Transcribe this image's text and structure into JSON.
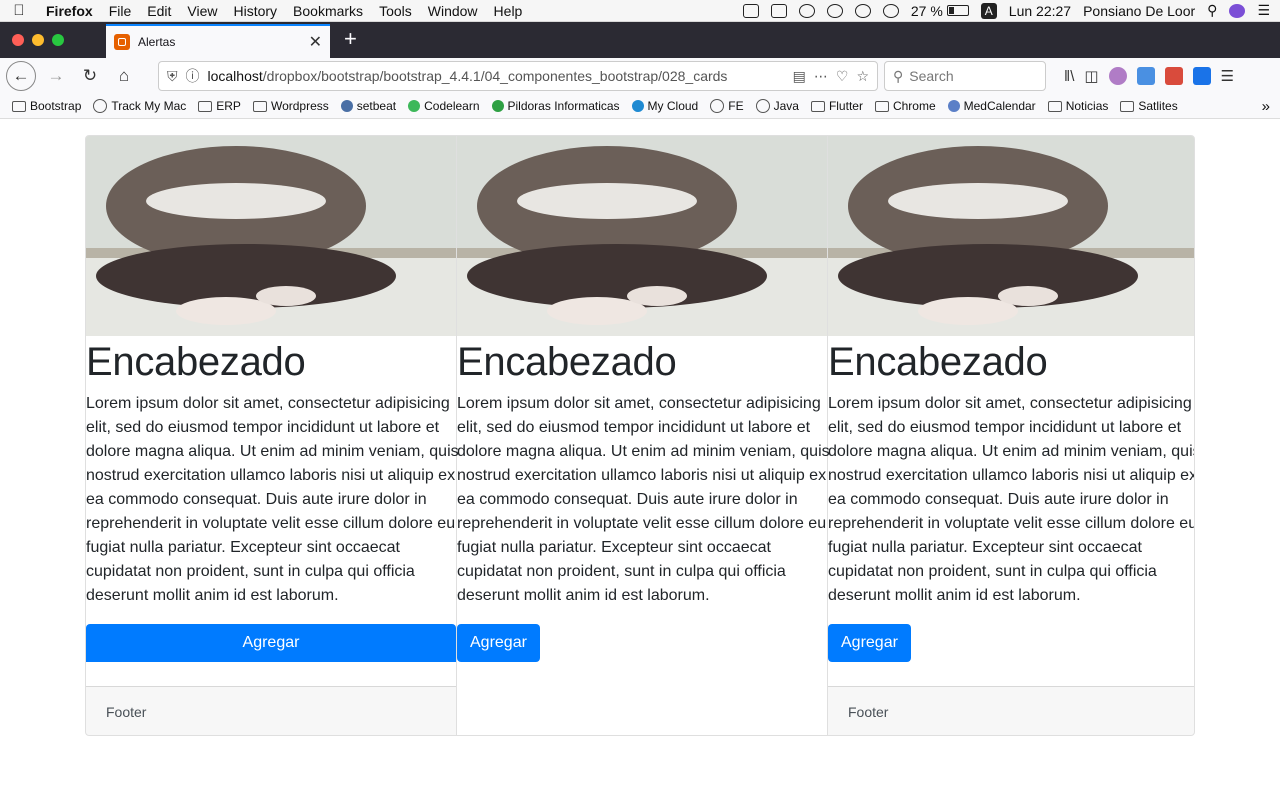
{
  "menubar": {
    "app": "Firefox",
    "menus": [
      "File",
      "Edit",
      "View",
      "History",
      "Bookmarks",
      "Tools",
      "Window",
      "Help"
    ],
    "battery": "27 %",
    "input_source": "A",
    "clock": "Lun 22:27",
    "user": "Ponsiano De Loor"
  },
  "tab": {
    "title": "Alertas"
  },
  "toolbar": {
    "url_host": "localhost",
    "url_path": "/dropbox/bootstrap/bootstrap_4.4.1/04_componentes_bootstrap/028_cards",
    "search_placeholder": "Search"
  },
  "bookmarks": [
    {
      "label": "Bootstrap",
      "icon": "folder-icon"
    },
    {
      "label": "Track My Mac",
      "icon": "globe-icon"
    },
    {
      "label": "ERP",
      "icon": "folder-icon"
    },
    {
      "label": "Wordpress",
      "icon": "folder-icon"
    },
    {
      "label": "setbeat",
      "icon": "headphones-icon"
    },
    {
      "label": "Codelearn",
      "icon": "codelearn-icon"
    },
    {
      "label": "Pildoras Informaticas",
      "icon": "pildoras-icon"
    },
    {
      "label": "My Cloud",
      "icon": "cloud-icon"
    },
    {
      "label": "FE",
      "icon": "globe-icon"
    },
    {
      "label": "Java",
      "icon": "globe-icon"
    },
    {
      "label": "Flutter",
      "icon": "folder-icon"
    },
    {
      "label": "Chrome",
      "icon": "folder-icon"
    },
    {
      "label": "MedCalendar",
      "icon": "medcalendar-icon"
    },
    {
      "label": "Noticias",
      "icon": "folder-icon"
    },
    {
      "label": "Satlites",
      "icon": "folder-icon"
    }
  ],
  "cards": [
    {
      "title": "Encabezado",
      "text": "Lorem ipsum dolor sit amet, consectetur adipisicing elit, sed do eiusmod tempor incididunt ut labore et dolore magna aliqua. Ut enim ad minim veniam, quis nostrud exercitation ullamco laboris nisi ut aliquip ex ea commodo consequat. Duis aute irure dolor in reprehenderit in voluptate velit esse cillum dolore eu fugiat nulla pariatur. Excepteur sint occaecat cupidatat non proident, sunt in culpa qui officia deserunt mollit anim id est laborum.",
      "button": "Agregar",
      "footer": "Footer"
    },
    {
      "title": "Encabezado",
      "text": "Lorem ipsum dolor sit amet, consectetur adipisicing elit, sed do eiusmod tempor incididunt ut labore et dolore magna aliqua. Ut enim ad minim veniam, quis nostrud exercitation ullamco laboris nisi ut aliquip ex ea commodo consequat. Duis aute irure dolor in reprehenderit in voluptate velit esse cillum dolore eu fugiat nulla pariatur. Excepteur sint occaecat cupidatat non proident, sunt in culpa qui officia deserunt mollit anim id est laborum.",
      "button": "Agregar"
    },
    {
      "title": "Encabezado",
      "text": "Lorem ipsum dolor sit amet, consectetur adipisicing elit, sed do eiusmod tempor incididunt ut labore et dolore magna aliqua. Ut enim ad minim veniam, quis nostrud exercitation ullamco laboris nisi ut aliquip ex ea commodo consequat. Duis aute irure dolor in reprehenderit in voluptate velit esse cillum dolore eu fugiat nulla pariatur. Excepteur sint occaecat cupidatat non proident, sunt in culpa qui officia deserunt mollit anim id est laborum.",
      "button": "Agregar",
      "footer": "Footer"
    }
  ],
  "colors": {
    "primary": "#007bff",
    "tab_accent": "#0a84ff"
  }
}
